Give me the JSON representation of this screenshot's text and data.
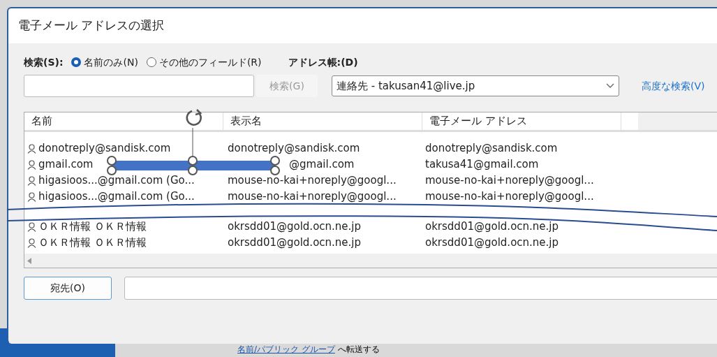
{
  "window": {
    "title": "電子メール アドレスの選択"
  },
  "search": {
    "label": "検索(S):",
    "options": [
      {
        "label": "名前のみ(N)",
        "selected": true
      },
      {
        "label": "その他のフィールド(R)",
        "selected": false
      }
    ],
    "button": {
      "label": "検索(G)",
      "disabled": true
    }
  },
  "address_book": {
    "label": "アドレス帳:(D)",
    "value": "連絡先 - takusan41@live.jp",
    "advanced_link": "高度な検索(V)"
  },
  "table": {
    "columns": [
      "名前",
      "表示名",
      "電子メール アドレス"
    ],
    "rows": [
      {
        "kind": "plain",
        "name": "donotreply@sandisk.com",
        "display_name": "donotreply@sandisk.com",
        "email": "donotreply@sandisk.com"
      },
      {
        "kind": "covered",
        "name": "gmail.com",
        "display_name": "@gmail.com",
        "email": "takusa41@gmail.com"
      },
      {
        "kind": "plain",
        "name": "higasioos...@gmail.com (Go...",
        "display_name": "mouse-no-kai+noreply@googl...",
        "email": "mouse-no-kai+noreply@googl..."
      },
      {
        "kind": "plain",
        "name": "higasioos...@gmail.com (Go...",
        "display_name": "mouse-no-kai+noreply@googl...",
        "email": "mouse-no-kai+noreply@googl..."
      },
      {
        "kind": "gap"
      },
      {
        "kind": "plain",
        "name": "ＯＫＲ情報 ＯＫＲ情報",
        "display_name": "okrsdd01@gold.ocn.ne.jp",
        "email": "okrsdd01@gold.ocn.ne.jp"
      },
      {
        "kind": "plain",
        "name": "ＯＫＲ情報 ＯＫＲ情報",
        "display_name": "okrsdd01@gold.ocn.ne.jp",
        "email": "okrsdd01@gold.ocn.ne.jp"
      }
    ]
  },
  "to_button": "宛先(O)",
  "background": {
    "link": "名前/パブリック グループ",
    "text": "へ転送する"
  }
}
